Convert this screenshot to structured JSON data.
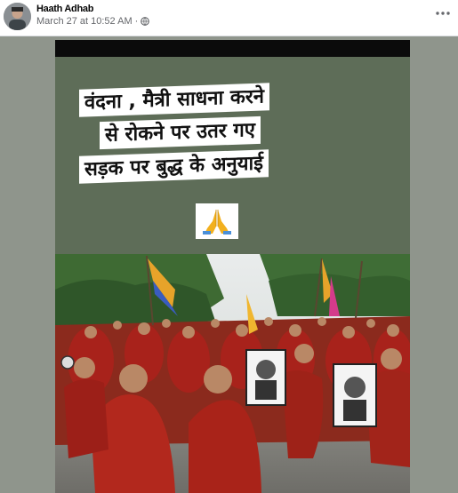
{
  "post": {
    "author": "Haath Adhab",
    "timestamp": "March 27 at 10:52 AM",
    "separator": "·",
    "audience_icon": "globe-icon",
    "more_icon": "more-options-icon"
  },
  "image": {
    "caption_lines": [
      "वंदना , मैत्री साधना करने",
      "से रोकने पर उतर गए",
      "सड़क पर बुद्ध के अनुयाई"
    ],
    "emoji": "folded-hands-icon",
    "photo": "monks-marching-photo"
  },
  "colors": {
    "panel_green": "#5e6d58",
    "robe_red": "#a8221b",
    "frame_gray": "#8f958c"
  }
}
